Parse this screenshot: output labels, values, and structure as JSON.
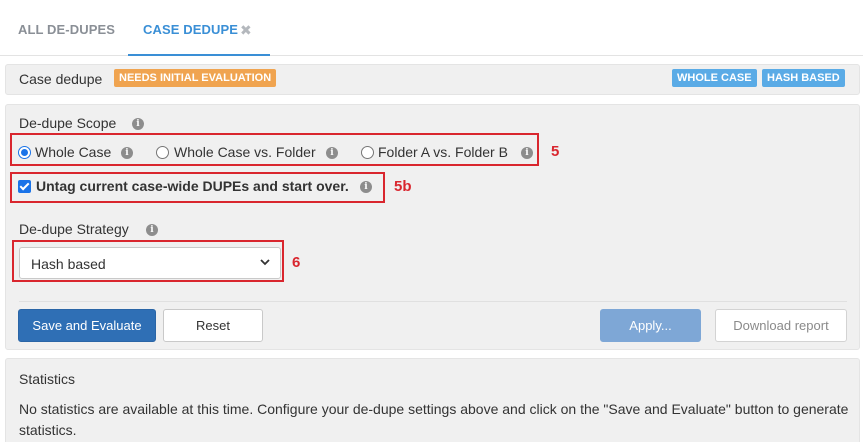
{
  "tabs": {
    "all_dedupes": "ALL DE-DUPES",
    "case_dedupe": "CASE DEDUPE",
    "close_glyph": "✖"
  },
  "header": {
    "title": "Case dedupe",
    "status_badge": "NEEDS INITIAL EVALUATION",
    "tags": [
      "WHOLE CASE",
      "HASH BASED"
    ]
  },
  "scope": {
    "label": "De-dupe Scope",
    "options": [
      {
        "label": "Whole Case",
        "selected": true
      },
      {
        "label": "Whole Case vs. Folder",
        "selected": false
      },
      {
        "label": "Folder A vs. Folder B",
        "selected": false
      }
    ],
    "annotation": "5"
  },
  "untag": {
    "label": "Untag current case-wide DUPEs and start over.",
    "checked": true,
    "annotation": "5b"
  },
  "strategy": {
    "label": "De-dupe Strategy",
    "selected": "Hash based",
    "annotation": "6"
  },
  "actions": {
    "save_evaluate": "Save and Evaluate",
    "reset": "Reset",
    "apply": "Apply...",
    "download_report": "Download report"
  },
  "statistics": {
    "title": "Statistics",
    "message": "No statistics are available at this time. Configure your de-dupe settings above and click on the \"Save and Evaluate\" button to generate statistics."
  },
  "colors": {
    "accent_blue": "#3a8fd6",
    "primary_button": "#2f6fb5",
    "status_orange": "#f0a450",
    "tag_blue": "#5aabe6",
    "annotation_red": "#d9262e"
  },
  "icons": {
    "info": "info-icon",
    "close": "close-icon",
    "chevron": "chevron-down-icon"
  }
}
